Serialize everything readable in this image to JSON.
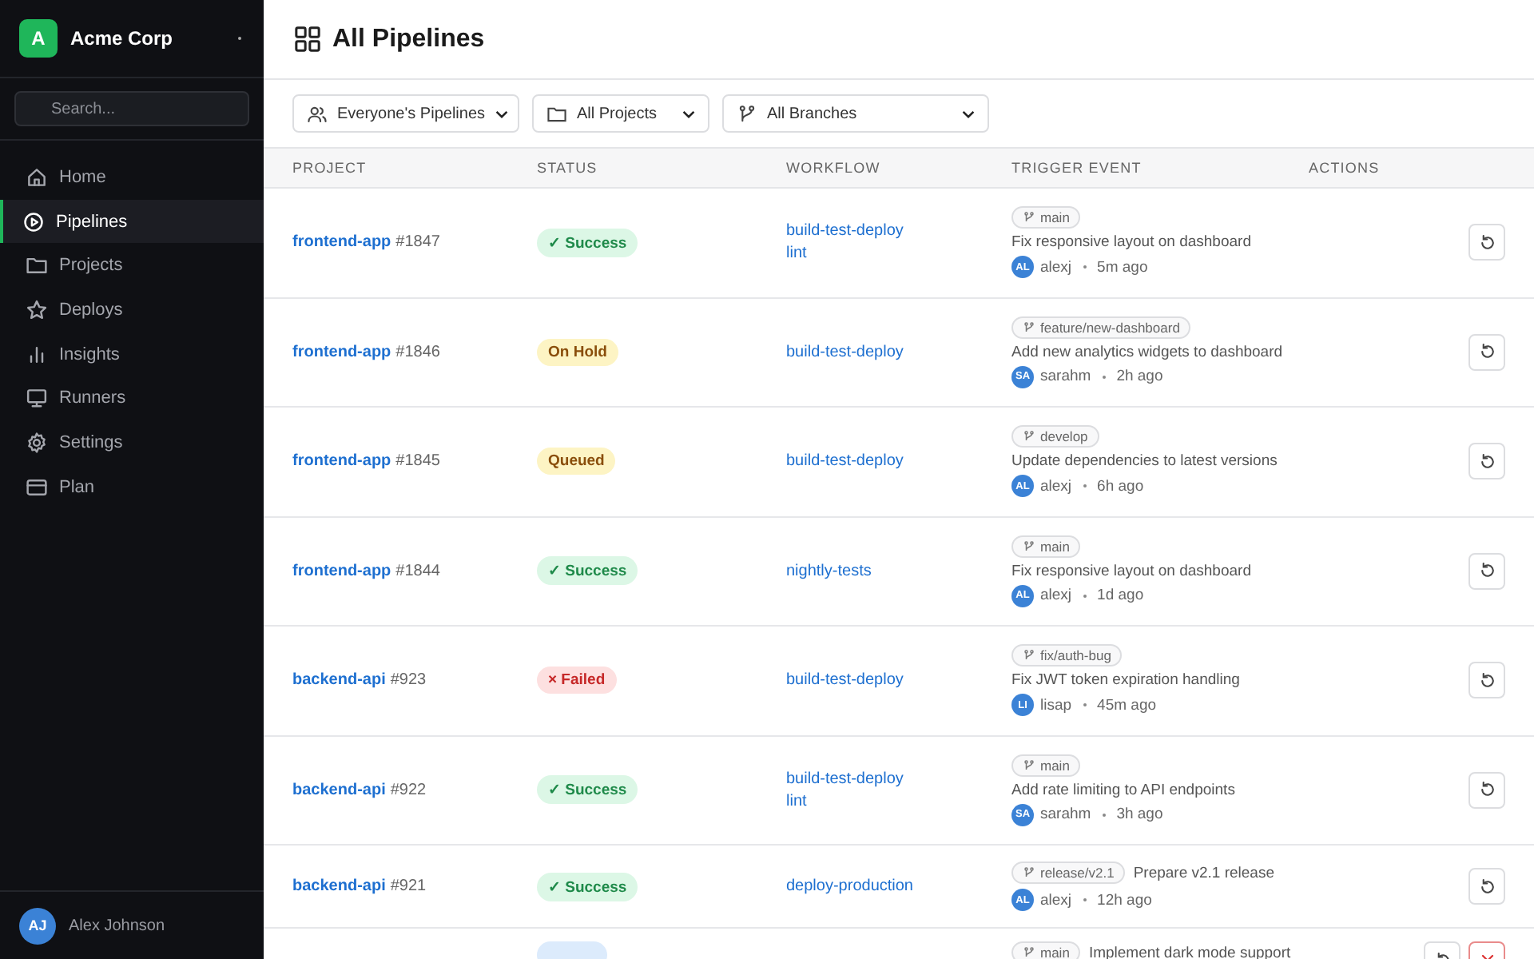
{
  "sidebar": {
    "org": {
      "logo": "A",
      "name": "Acme Corp"
    },
    "search": {
      "placeholder": "Search..."
    },
    "items": [
      {
        "label": "Home",
        "selected": false
      },
      {
        "label": "Pipelines",
        "selected": true
      },
      {
        "label": "Projects",
        "selected": false
      },
      {
        "label": "Deploys",
        "selected": false
      },
      {
        "label": "Insights",
        "selected": false
      },
      {
        "label": "Runners",
        "selected": false
      },
      {
        "label": "Settings",
        "selected": false
      },
      {
        "label": "Plan",
        "selected": false
      }
    ],
    "user": {
      "initials": "AJ",
      "name": "Alex Johnson"
    }
  },
  "header": {
    "title": "All Pipelines"
  },
  "filters": [
    {
      "label": "Everyone's Pipelines"
    },
    {
      "label": "All Projects"
    },
    {
      "label": "All Branches"
    }
  ],
  "table": {
    "columns": [
      "PROJECT",
      "STATUS",
      "WORKFLOW",
      "TRIGGER EVENT",
      "ACTIONS"
    ],
    "rows": [
      {
        "project": "frontend-app",
        "number": "#1847",
        "status": {
          "kind": "success",
          "label": "✓ Success"
        },
        "workflows": [
          "build-test-deploy",
          "lint"
        ],
        "trigger": {
          "kind": "stacked",
          "branch": "main",
          "message": "Fix responsive layout on dashboard",
          "initials": "AL",
          "user": "alexj",
          "time": "5m ago"
        },
        "actions": [
          {
            "kind": "retry"
          }
        ]
      },
      {
        "project": "frontend-app",
        "number": "#1846",
        "status": {
          "kind": "hold",
          "label": "On Hold"
        },
        "workflows": [
          "build-test-deploy"
        ],
        "trigger": {
          "kind": "stacked",
          "branch": "feature/new-dashboard",
          "message": "Add new analytics widgets to dashboard",
          "initials": "SA",
          "user": "sarahm",
          "time": "2h ago"
        },
        "actions": [
          {
            "kind": "retry"
          }
        ]
      },
      {
        "project": "frontend-app",
        "number": "#1845",
        "status": {
          "kind": "queued",
          "label": "Queued"
        },
        "workflows": [
          "build-test-deploy"
        ],
        "trigger": {
          "kind": "stacked",
          "branch": "develop",
          "message": "Update dependencies to latest versions",
          "initials": "AL",
          "user": "alexj",
          "time": "6h ago"
        },
        "actions": [
          {
            "kind": "retry"
          }
        ]
      },
      {
        "project": "frontend-app",
        "number": "#1844",
        "status": {
          "kind": "success",
          "label": "✓ Success"
        },
        "workflows": [
          "nightly-tests"
        ],
        "trigger": {
          "kind": "stacked",
          "branch": "main",
          "message": "Fix responsive layout on dashboard",
          "initials": "AL",
          "user": "alexj",
          "time": "1d ago"
        },
        "actions": [
          {
            "kind": "retry"
          }
        ]
      },
      {
        "project": "backend-api",
        "number": "#923",
        "status": {
          "kind": "failed",
          "label": "× Failed"
        },
        "workflows": [
          "build-test-deploy"
        ],
        "trigger": {
          "kind": "stacked",
          "branch": "fix/auth-bug",
          "message": "Fix JWT token expiration handling",
          "initials": "LI",
          "user": "lisap",
          "time": "45m ago"
        },
        "actions": [
          {
            "kind": "retry"
          }
        ]
      },
      {
        "project": "backend-api",
        "number": "#922",
        "status": {
          "kind": "success",
          "label": "✓ Success"
        },
        "workflows": [
          "build-test-deploy",
          "lint"
        ],
        "trigger": {
          "kind": "stacked",
          "branch": "main",
          "message": "Add rate limiting to API endpoints",
          "initials": "SA",
          "user": "sarahm",
          "time": "3h ago"
        },
        "actions": [
          {
            "kind": "retry"
          }
        ]
      },
      {
        "project": "backend-api",
        "number": "#921",
        "status": {
          "kind": "success",
          "label": "✓ Success"
        },
        "workflows": [
          "deploy-production"
        ],
        "trigger": {
          "kind": "inline",
          "branch": "release/v2.1",
          "message": "Prepare v2.1 release",
          "initials": "AL",
          "user": "alexj",
          "time": "12h ago"
        },
        "actions": [
          {
            "kind": "retry"
          }
        ]
      },
      {
        "status": {
          "kind": "running"
        },
        "trigger": {
          "kind": "inline",
          "branch": "main",
          "message": "Implement dark mode support"
        },
        "actions": [
          {
            "kind": "retry"
          },
          {
            "kind": "cancel"
          }
        ]
      }
    ]
  }
}
